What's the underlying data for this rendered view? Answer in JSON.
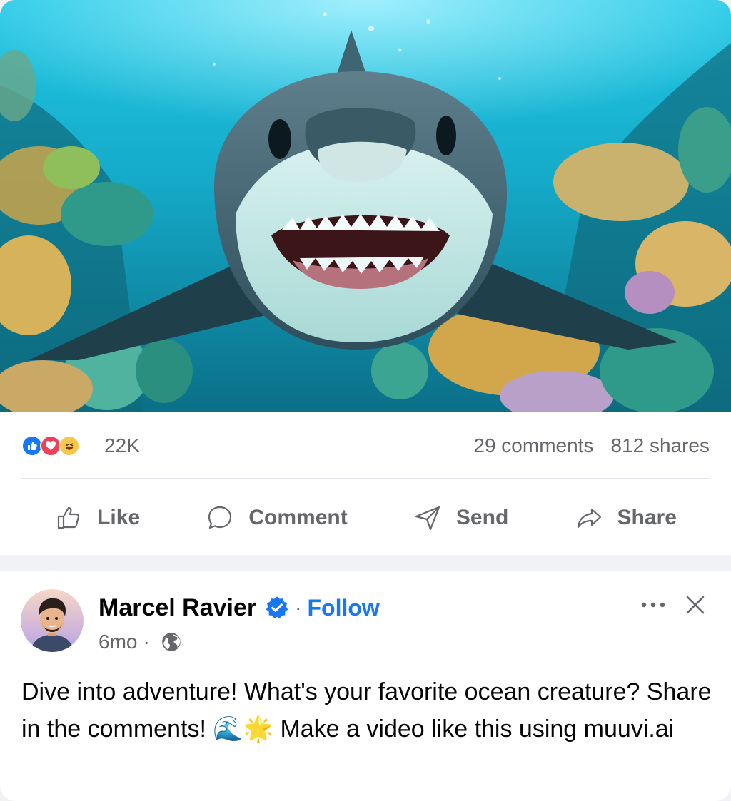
{
  "top_post": {
    "image_alt": "Shark swimming over coral reef",
    "reactions": {
      "icons": [
        "like-icon",
        "love-icon",
        "haha-icon"
      ],
      "count": "22K"
    },
    "comments": "29 comments",
    "shares": "812 shares",
    "actions": {
      "like": "Like",
      "comment": "Comment",
      "send": "Send",
      "share": "Share"
    }
  },
  "post": {
    "author": "Marcel Ravier",
    "separator": "·",
    "follow_label": "Follow",
    "time": "6mo",
    "text": "Dive into adventure! What's your favorite ocean creature? Share in the comments! 🌊🌟 Make a video like this using muuvi.ai"
  },
  "colors": {
    "accent": "#1877f2",
    "secondary_text": "#65676b",
    "love": "#f33e58",
    "haha": "#f7c74a"
  }
}
